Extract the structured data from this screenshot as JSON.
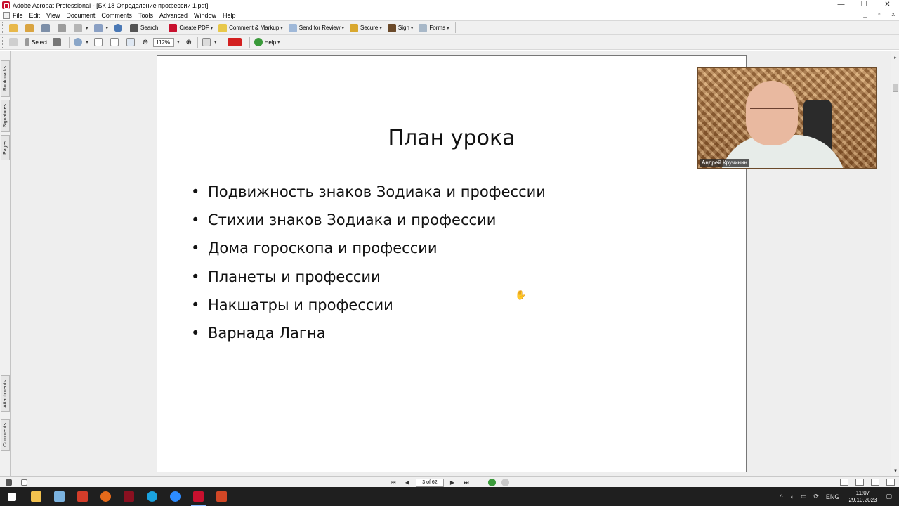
{
  "window": {
    "title": "Adobe Acrobat Professional - [БК 18 Определение профессии 1.pdf]",
    "controls": {
      "minimize": "—",
      "restore": "❐",
      "close": "✕"
    }
  },
  "menubar": {
    "items": [
      "File",
      "Edit",
      "View",
      "Document",
      "Comments",
      "Tools",
      "Advanced",
      "Window",
      "Help"
    ],
    "doc_controls": {
      "minimize": "_",
      "restore": "▫",
      "close": "x"
    }
  },
  "toolbar1": {
    "search": "Search",
    "create_pdf": "Create PDF",
    "comment_markup": "Comment & Markup",
    "send_review": "Send for Review",
    "secure": "Secure",
    "sign": "Sign",
    "forms": "Forms"
  },
  "toolbar2": {
    "select": "Select",
    "zoom_level": "112%",
    "help": "Help"
  },
  "left_tabs": {
    "bookmarks": "Bookmarks",
    "signatures": "Signatures",
    "pages": "Pages",
    "attachments": "Attachments",
    "comments": "Comments"
  },
  "document": {
    "title": "План урока",
    "bullets": [
      "Подвижность знаков Зодиака и профессии",
      "Стихии знаков Зодиака и профессии",
      "Дома гороскопа и профессии",
      "Планеты и профессии",
      "Накшатры и профессии",
      "Варнада Лагна"
    ]
  },
  "webcam": {
    "name": "Андрей Кручинин"
  },
  "navigation": {
    "page_indicator": "3 of 62"
  },
  "taskbar": {
    "language": "ENG",
    "time": "11:07",
    "date": "29.10.2023"
  },
  "colors": {
    "acrobat_red": "#c8102e",
    "taskbar_bg": "#1f1f1f",
    "doc_bg": "#eeeeee"
  }
}
